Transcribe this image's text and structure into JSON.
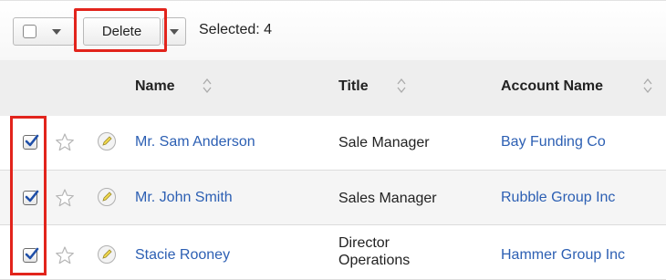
{
  "toolbar": {
    "delete_label": "Delete",
    "selected_text": "Selected: 4"
  },
  "columns": {
    "name": "Name",
    "title": "Title",
    "account": "Account Name"
  },
  "rows": [
    {
      "name": "Mr. Sam Anderson",
      "title": "Sale Manager",
      "account": "Bay Funding Co",
      "checked": true
    },
    {
      "name": "Mr. John Smith",
      "title": "Sales Manager",
      "account": "Rubble Group Inc",
      "checked": true
    },
    {
      "name": "Stacie Rooney",
      "title_line1": "Director",
      "title_line2": "Operations",
      "account": "Hammer Group Inc",
      "checked": true
    }
  ],
  "colors": {
    "link": "#2c5fb3",
    "highlight": "#e2241c",
    "checkmark": "#1f4fa8"
  }
}
